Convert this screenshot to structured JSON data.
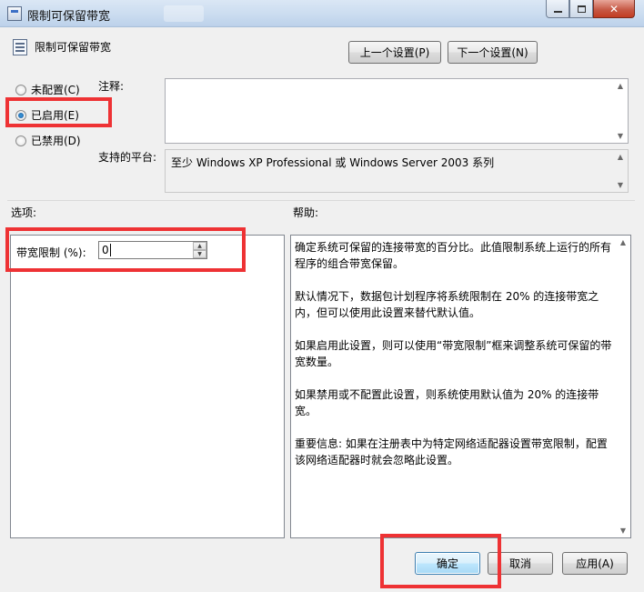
{
  "window": {
    "title": "限制可保留带宽",
    "close_glyph": "✕"
  },
  "header": {
    "policy_name": "限制可保留带宽",
    "prev_button": "上一个设置(P)",
    "next_button": "下一个设置(N)"
  },
  "state": {
    "options": [
      {
        "label": "未配置(C)",
        "checked": false
      },
      {
        "label": "已启用(E)",
        "checked": true
      },
      {
        "label": "已禁用(D)",
        "checked": false
      }
    ]
  },
  "comment": {
    "label": "注释:",
    "value": ""
  },
  "platform": {
    "label": "支持的平台:",
    "value": "至少 Windows XP Professional 或 Windows Server 2003 系列"
  },
  "options_section": {
    "label": "选项:",
    "bandwidth_label": "带宽限制 (%):",
    "bandwidth_value": "0"
  },
  "help_section": {
    "label": "帮助:",
    "paragraphs": [
      "确定系统可保留的连接带宽的百分比。此值限制系统上运行的所有程序的组合带宽保留。",
      "默认情况下，数据包计划程序将系统限制在 20% 的连接带宽之内，但可以使用此设置来替代默认值。",
      "如果启用此设置，则可以使用“带宽限制”框来调整系统可保留的带宽数量。",
      "如果禁用或不配置此设置，则系统使用默认值为 20% 的连接带宽。",
      "重要信息: 如果在注册表中为特定网络适配器设置带宽限制，配置该网络适配器时就会忽略此设置。"
    ]
  },
  "footer": {
    "ok": "确定",
    "cancel": "取消",
    "apply": "应用(A)"
  },
  "colors": {
    "highlight": "#ee3234",
    "dialog_bg": "#f0f0f0"
  }
}
